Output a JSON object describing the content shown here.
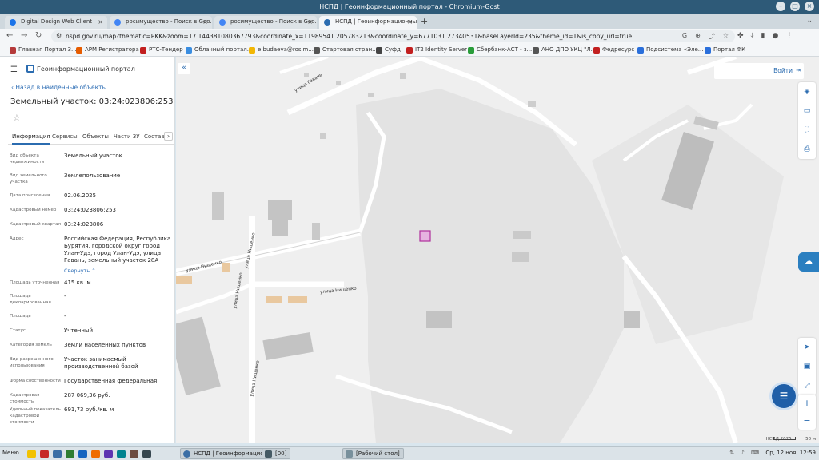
{
  "window": {
    "title": "НСПД | Геоинформационный портал - Chromium-Gost",
    "controls": [
      "–",
      "□",
      "×"
    ]
  },
  "tabs": [
    {
      "label": "Digital Design Web Client",
      "active": false,
      "color": "#1a73e8"
    },
    {
      "label": "росимущество - Поиск в Goo...",
      "active": false,
      "color": "#4285f4"
    },
    {
      "label": "росимущество - Поиск в Goo...",
      "active": false,
      "color": "#4285f4"
    },
    {
      "label": "НСПД | Геоинформационный п...",
      "active": true,
      "color": "#2b6cb0"
    }
  ],
  "newtab": "+",
  "address": {
    "url": "nspd.gov.ru/map?thematic=PKK&zoom=17.144381080367793&coordinate_x=11989541.205783213&coordinate_y=6771031.27340531&baseLayerId=235&theme_id=1&is_copy_url=true"
  },
  "bookmarks": [
    {
      "label": "Главная Портал З...",
      "color": "#b53a3a"
    },
    {
      "label": "АРМ Регистратора",
      "color": "#e65c00"
    },
    {
      "label": "РТС-Тендер",
      "color": "#c21f1f"
    },
    {
      "label": "Облачный портал...",
      "color": "#3a8de0"
    },
    {
      "label": "e.budaeva@rosim...",
      "color": "#f2b705"
    },
    {
      "label": "Стартовая стран...",
      "color": "#555555"
    },
    {
      "label": "Суфд",
      "color": "#444444"
    },
    {
      "label": "IT2 Identity Server",
      "color": "#c21f1f"
    },
    {
      "label": "Сбербанк-АСТ - з...",
      "color": "#2a9d3a"
    },
    {
      "label": "АНО ДПО УКЦ \"Л...",
      "color": "#555555"
    },
    {
      "label": "Федресурс",
      "color": "#c21f1f"
    },
    {
      "label": "Подсистема «Эле...",
      "color": "#2a6fdb"
    },
    {
      "label": "Портал ФК",
      "color": "#2a6fdb"
    }
  ],
  "sidebar": {
    "brand": "Геоинформационный портал",
    "back": "Назад в найденные объекты",
    "title": "Земельный участок: 03:24:023806:253",
    "tabs": [
      "Информация",
      "Сервисы",
      "Объекты",
      "Части ЗУ",
      "Состав Е"
    ],
    "props": [
      {
        "k": "Вид объекта недвижимости",
        "v": "Земельный участок"
      },
      {
        "k": "Вид земельного участка",
        "v": "Землепользование"
      },
      {
        "k": "Дата присвоения",
        "v": "02.06.2025"
      },
      {
        "k": "Кадастровый номер",
        "v": "03:24:023806:253"
      },
      {
        "k": "Кадастровый квартал",
        "v": "03:24:023806"
      },
      {
        "k": "Адрес",
        "v": "Российская Федерация, Республика Бурятия, городской округ город Улан-Удэ, город Улан-Удэ, улица Гавань, земельный участок 28А"
      },
      {
        "k": "Площадь уточненная",
        "v": "415 кв. м"
      },
      {
        "k": "Площадь декларированная",
        "v": "-"
      },
      {
        "k": "Площадь",
        "v": "-"
      },
      {
        "k": "Статус",
        "v": "Учтенный"
      },
      {
        "k": "Категория земель",
        "v": "Земли населенных пунктов"
      },
      {
        "k": "Вид разрешенного использования",
        "v": "Участок занимаемый производственной базой"
      },
      {
        "k": "Форма собственности",
        "v": "Государственная федеральная"
      },
      {
        "k": "Кадастровая стоимость",
        "v": "287 069,36 руб."
      },
      {
        "k": "Удельный показатель кадастровой стоимости",
        "v": "691,73 руб./кв. м"
      }
    ],
    "collapse": "Свернуть"
  },
  "map": {
    "login": "Войти",
    "streets": [
      "улица Гавань",
      "улица Нищенко",
      "улица Нищенко",
      "улица Нищенко",
      "улица Нищенко",
      "улица Нищенко"
    ],
    "footer": "НСПД 2025",
    "scale": "50 м"
  },
  "taskbar": {
    "start": "Меню",
    "tasks": [
      "НСПД | Геоинформацио...",
      "[00]",
      "[Рабочий стол]"
    ],
    "datetime": "Ср, 12 ноя, 12:59"
  }
}
